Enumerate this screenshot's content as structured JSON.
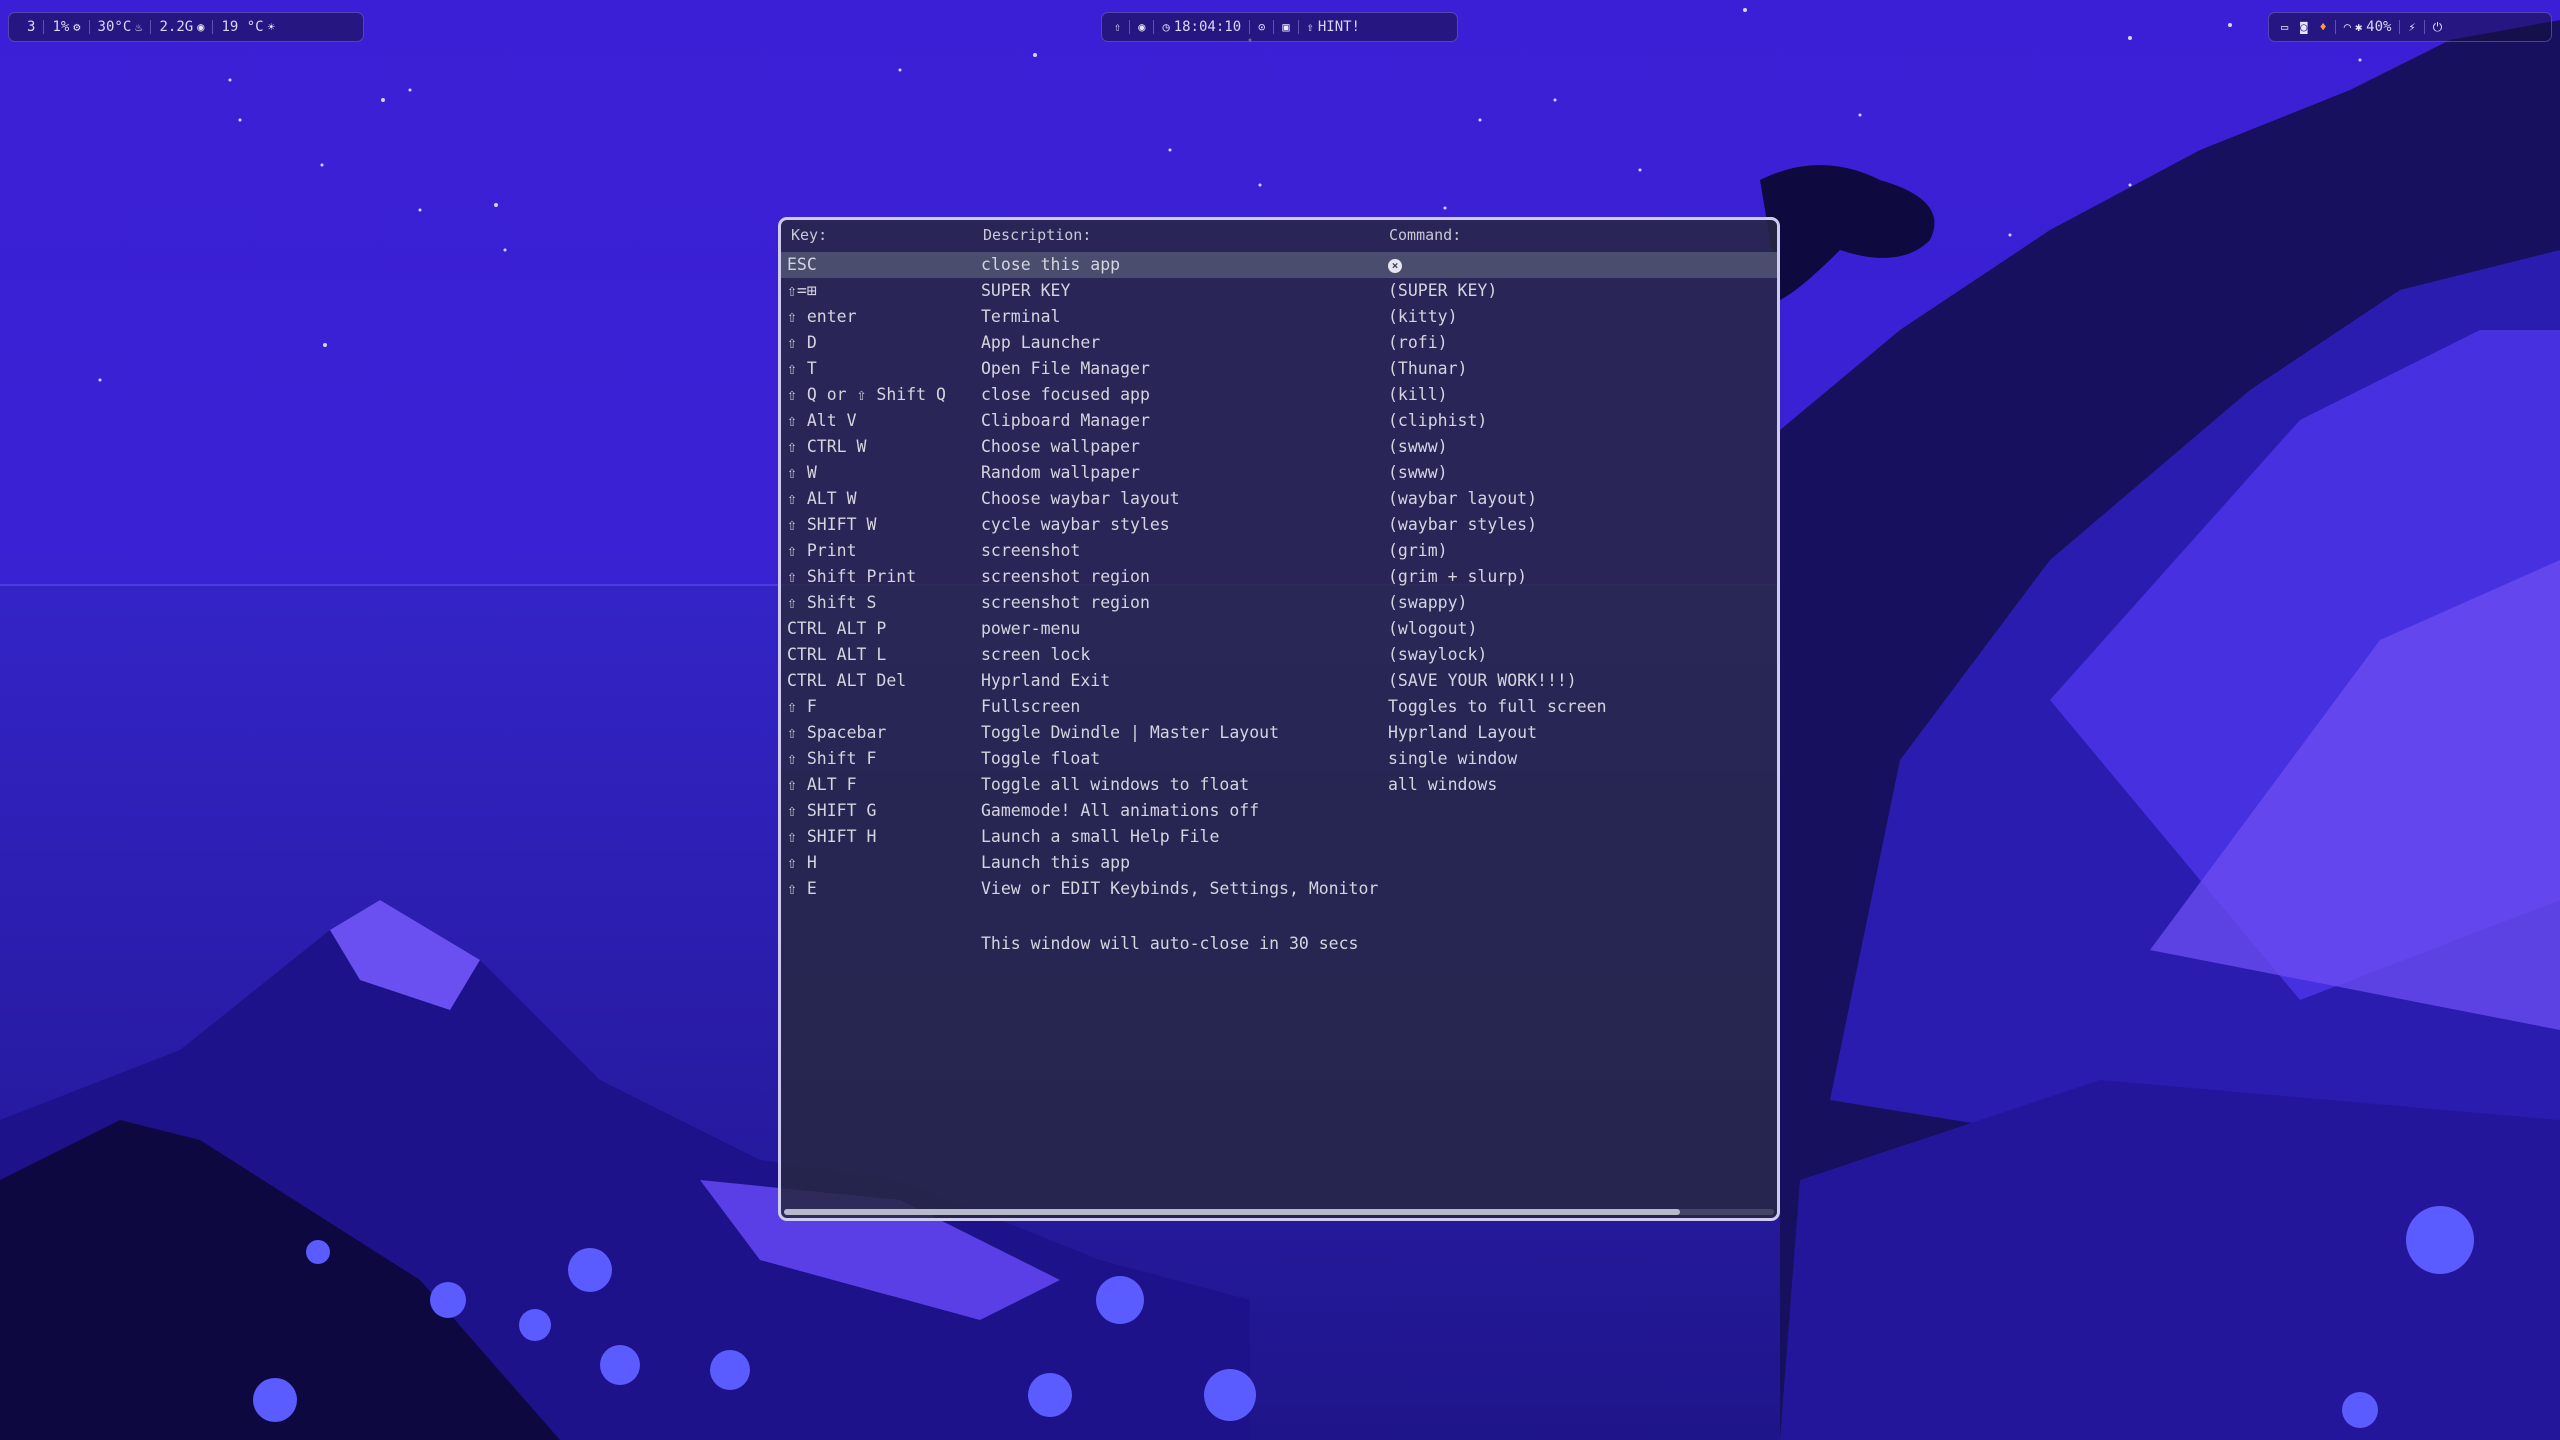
{
  "colors": {
    "sky": "#3b1fd6",
    "rock_dark": "#15105c",
    "rock_mid": "#2a1aa8",
    "rock_light": "#6a4cf0",
    "window_bg": "#262842",
    "window_border": "#cfcaf0",
    "selected_row": "#4a4d6e"
  },
  "topbar_left": {
    "workspace": "3",
    "cpu": "1%",
    "cpu_icon": "gear-icon",
    "temp": "30°C",
    "temp_icon": "flame-icon",
    "memory": "2.2G",
    "memory_icon": "memory-icon",
    "weather": "19 °C",
    "weather_icon": "sun-icon"
  },
  "topbar_center": {
    "arch_icon": "arch-icon",
    "idle_icon": "eye-icon",
    "clock": "18:04:10",
    "clock_icon": "clock-icon",
    "record_icon": "record-icon",
    "lock_icon": "lock-icon",
    "hint_label": "HINT!",
    "hint_icon": "arch-icon"
  },
  "topbar_right": {
    "tray_icons": [
      "window-icon",
      "discord-icon",
      "flame-icon"
    ],
    "volume": "40%",
    "headphone_icon": "headphones-icon",
    "bluetooth_icon": "bluetooth-icon",
    "notification_icon": "bell-off-icon",
    "power_icon": "power-icon"
  },
  "help": {
    "header": {
      "key": "Key:",
      "description": "Description:",
      "command": "Command:"
    },
    "rows": [
      {
        "key": "ESC",
        "desc": "close this app",
        "cmd": ""
      },
      {
        "key": "⇧=⊞",
        "desc": "SUPER KEY",
        "cmd": "(SUPER KEY)"
      },
      {
        "key": "⇧ enter",
        "desc": "Terminal",
        "cmd": "(kitty)"
      },
      {
        "key": "⇧ D",
        "desc": "App Launcher",
        "cmd": "(rofi)"
      },
      {
        "key": "⇧ T",
        "desc": "Open File Manager",
        "cmd": "(Thunar)"
      },
      {
        "key": "⇧ Q or ⇧ Shift Q",
        "desc": "close focused app",
        "cmd": "(kill)"
      },
      {
        "key": "⇧ Alt V",
        "desc": "Clipboard Manager",
        "cmd": "(cliphist)"
      },
      {
        "key": "⇧ CTRL W",
        "desc": "Choose wallpaper",
        "cmd": "(swww)"
      },
      {
        "key": "⇧ W",
        "desc": "Random wallpaper",
        "cmd": "(swww)"
      },
      {
        "key": "⇧ ALT W",
        "desc": "Choose waybar layout",
        "cmd": "(waybar layout)"
      },
      {
        "key": "⇧ SHIFT W",
        "desc": "cycle waybar styles",
        "cmd": "(waybar styles)"
      },
      {
        "key": "⇧ Print",
        "desc": "screenshot",
        "cmd": "(grim)"
      },
      {
        "key": "⇧ Shift Print",
        "desc": "screenshot region",
        "cmd": "(grim + slurp)"
      },
      {
        "key": "⇧ Shift S",
        "desc": "screenshot region",
        "cmd": "(swappy)"
      },
      {
        "key": "CTRL ALT P",
        "desc": "power-menu",
        "cmd": "(wlogout)"
      },
      {
        "key": "CTRL ALT L",
        "desc": "screen lock",
        "cmd": "(swaylock)"
      },
      {
        "key": "CTRL ALT Del",
        "desc": "Hyprland Exit",
        "cmd": "(SAVE YOUR WORK!!!)"
      },
      {
        "key": "⇧ F",
        "desc": "Fullscreen",
        "cmd": "Toggles to full screen"
      },
      {
        "key": "⇧ Spacebar",
        "desc": "Toggle Dwindle | Master Layout",
        "cmd": "Hyprland Layout"
      },
      {
        "key": "⇧ Shift F",
        "desc": "Toggle float",
        "cmd": "single window"
      },
      {
        "key": "⇧ ALT F",
        "desc": "Toggle all windows to float",
        "cmd": "all windows"
      },
      {
        "key": "⇧ SHIFT G",
        "desc": "Gamemode! All animations off",
        "cmd": ""
      },
      {
        "key": "⇧ SHIFT H",
        "desc": "Launch a small Help File",
        "cmd": ""
      },
      {
        "key": "⇧ H",
        "desc": "Launch this app",
        "cmd": ""
      },
      {
        "key": "⇧ E",
        "desc": "View or EDIT Keybinds, Settings, Monitor",
        "cmd": ""
      }
    ],
    "footer": "This window will auto-close in 30 secs"
  }
}
